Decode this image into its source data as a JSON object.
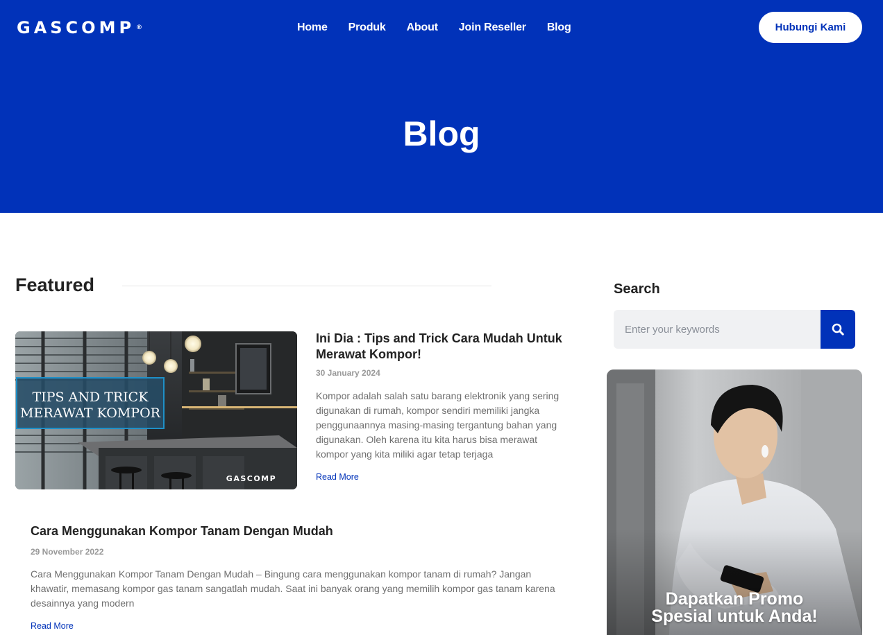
{
  "brand": {
    "name": "GASCOMP",
    "reg": "®"
  },
  "nav": {
    "items": [
      "Home",
      "Produk",
      "About",
      "Join Reseller",
      "Blog"
    ]
  },
  "header": {
    "cta_label": "Hubungi Kami"
  },
  "hero": {
    "title": "Blog"
  },
  "featured": {
    "heading": "Featured"
  },
  "posts": [
    {
      "title": "Ini Dia : Tips and Trick Cara Mudah Untuk Merawat Kompor!",
      "date": "30 January 2024",
      "excerpt": "Kompor adalah salah satu barang elektronik yang sering digunakan di rumah, kompor sendiri memiliki jangka penggunaannya masing-masing tergantung bahan yang digunakan. Oleh karena itu kita harus bisa merawat kompor yang kita miliki agar tetap terjaga",
      "read_more": "Read More",
      "image_overlay": [
        "TIPS AND TRICK",
        "MERAWAT KOMPOR"
      ],
      "image_logo": "GASCOMP"
    },
    {
      "title": "Cara Menggunakan Kompor Tanam Dengan Mudah",
      "date": "29 November 2022",
      "excerpt": "Cara Menggunakan Kompor Tanam Dengan Mudah – Bingung cara menggunakan kompor tanam di rumah? Jangan khawatir, memasang kompor gas tanam sangatlah mudah. Saat ini banyak orang yang memilih kompor gas tanam karena desainnya yang modern",
      "read_more": "Read More"
    }
  ],
  "sidebar": {
    "search_heading": "Search",
    "search_placeholder": "Enter your keywords",
    "search_icon": "search-icon",
    "promo_text": [
      "Dapatkan Promo",
      "Spesial untuk Anda!"
    ]
  },
  "colors": {
    "brand_blue": "#0132b9",
    "link": "#0132b9"
  }
}
